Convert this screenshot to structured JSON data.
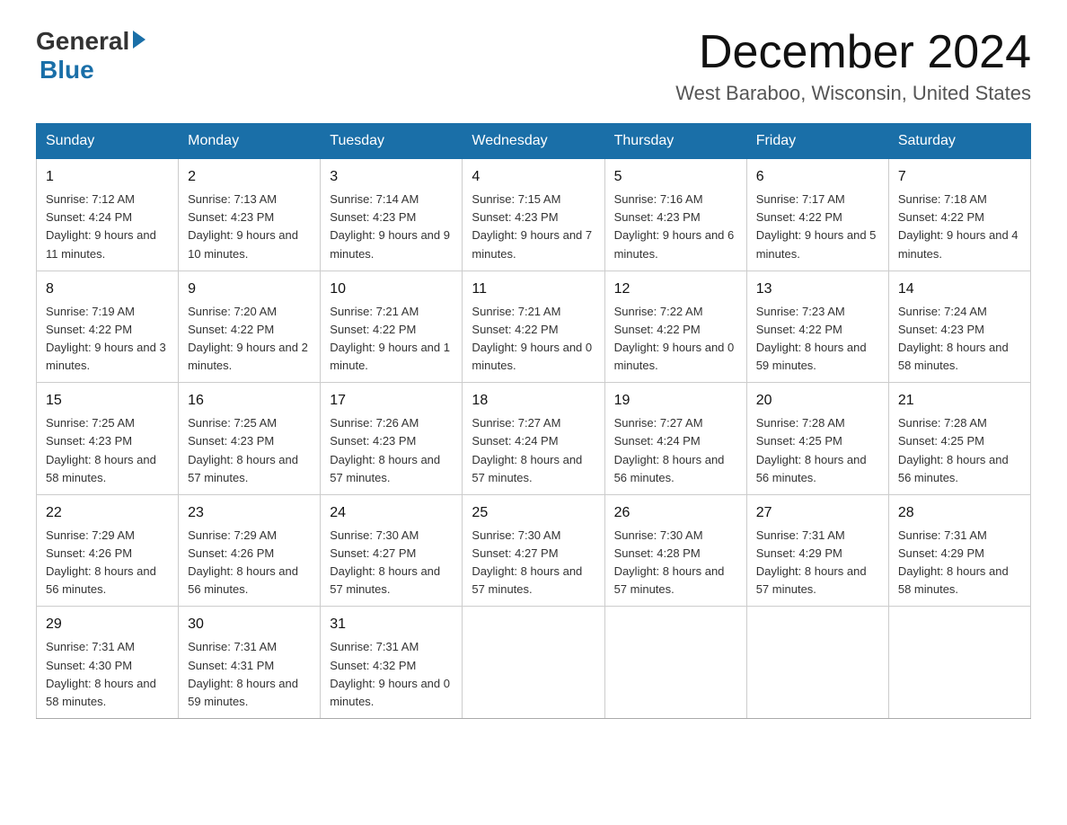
{
  "header": {
    "logo_general": "General",
    "logo_blue": "Blue",
    "month_title": "December 2024",
    "location": "West Baraboo, Wisconsin, United States"
  },
  "days_of_week": [
    "Sunday",
    "Monday",
    "Tuesday",
    "Wednesday",
    "Thursday",
    "Friday",
    "Saturday"
  ],
  "weeks": [
    [
      {
        "day": "1",
        "sunrise": "7:12 AM",
        "sunset": "4:24 PM",
        "daylight": "9 hours and 11 minutes."
      },
      {
        "day": "2",
        "sunrise": "7:13 AM",
        "sunset": "4:23 PM",
        "daylight": "9 hours and 10 minutes."
      },
      {
        "day": "3",
        "sunrise": "7:14 AM",
        "sunset": "4:23 PM",
        "daylight": "9 hours and 9 minutes."
      },
      {
        "day": "4",
        "sunrise": "7:15 AM",
        "sunset": "4:23 PM",
        "daylight": "9 hours and 7 minutes."
      },
      {
        "day": "5",
        "sunrise": "7:16 AM",
        "sunset": "4:23 PM",
        "daylight": "9 hours and 6 minutes."
      },
      {
        "day": "6",
        "sunrise": "7:17 AM",
        "sunset": "4:22 PM",
        "daylight": "9 hours and 5 minutes."
      },
      {
        "day": "7",
        "sunrise": "7:18 AM",
        "sunset": "4:22 PM",
        "daylight": "9 hours and 4 minutes."
      }
    ],
    [
      {
        "day": "8",
        "sunrise": "7:19 AM",
        "sunset": "4:22 PM",
        "daylight": "9 hours and 3 minutes."
      },
      {
        "day": "9",
        "sunrise": "7:20 AM",
        "sunset": "4:22 PM",
        "daylight": "9 hours and 2 minutes."
      },
      {
        "day": "10",
        "sunrise": "7:21 AM",
        "sunset": "4:22 PM",
        "daylight": "9 hours and 1 minute."
      },
      {
        "day": "11",
        "sunrise": "7:21 AM",
        "sunset": "4:22 PM",
        "daylight": "9 hours and 0 minutes."
      },
      {
        "day": "12",
        "sunrise": "7:22 AM",
        "sunset": "4:22 PM",
        "daylight": "9 hours and 0 minutes."
      },
      {
        "day": "13",
        "sunrise": "7:23 AM",
        "sunset": "4:22 PM",
        "daylight": "8 hours and 59 minutes."
      },
      {
        "day": "14",
        "sunrise": "7:24 AM",
        "sunset": "4:23 PM",
        "daylight": "8 hours and 58 minutes."
      }
    ],
    [
      {
        "day": "15",
        "sunrise": "7:25 AM",
        "sunset": "4:23 PM",
        "daylight": "8 hours and 58 minutes."
      },
      {
        "day": "16",
        "sunrise": "7:25 AM",
        "sunset": "4:23 PM",
        "daylight": "8 hours and 57 minutes."
      },
      {
        "day": "17",
        "sunrise": "7:26 AM",
        "sunset": "4:23 PM",
        "daylight": "8 hours and 57 minutes."
      },
      {
        "day": "18",
        "sunrise": "7:27 AM",
        "sunset": "4:24 PM",
        "daylight": "8 hours and 57 minutes."
      },
      {
        "day": "19",
        "sunrise": "7:27 AM",
        "sunset": "4:24 PM",
        "daylight": "8 hours and 56 minutes."
      },
      {
        "day": "20",
        "sunrise": "7:28 AM",
        "sunset": "4:25 PM",
        "daylight": "8 hours and 56 minutes."
      },
      {
        "day": "21",
        "sunrise": "7:28 AM",
        "sunset": "4:25 PM",
        "daylight": "8 hours and 56 minutes."
      }
    ],
    [
      {
        "day": "22",
        "sunrise": "7:29 AM",
        "sunset": "4:26 PM",
        "daylight": "8 hours and 56 minutes."
      },
      {
        "day": "23",
        "sunrise": "7:29 AM",
        "sunset": "4:26 PM",
        "daylight": "8 hours and 56 minutes."
      },
      {
        "day": "24",
        "sunrise": "7:30 AM",
        "sunset": "4:27 PM",
        "daylight": "8 hours and 57 minutes."
      },
      {
        "day": "25",
        "sunrise": "7:30 AM",
        "sunset": "4:27 PM",
        "daylight": "8 hours and 57 minutes."
      },
      {
        "day": "26",
        "sunrise": "7:30 AM",
        "sunset": "4:28 PM",
        "daylight": "8 hours and 57 minutes."
      },
      {
        "day": "27",
        "sunrise": "7:31 AM",
        "sunset": "4:29 PM",
        "daylight": "8 hours and 57 minutes."
      },
      {
        "day": "28",
        "sunrise": "7:31 AM",
        "sunset": "4:29 PM",
        "daylight": "8 hours and 58 minutes."
      }
    ],
    [
      {
        "day": "29",
        "sunrise": "7:31 AM",
        "sunset": "4:30 PM",
        "daylight": "8 hours and 58 minutes."
      },
      {
        "day": "30",
        "sunrise": "7:31 AM",
        "sunset": "4:31 PM",
        "daylight": "8 hours and 59 minutes."
      },
      {
        "day": "31",
        "sunrise": "7:31 AM",
        "sunset": "4:32 PM",
        "daylight": "9 hours and 0 minutes."
      },
      null,
      null,
      null,
      null
    ]
  ]
}
